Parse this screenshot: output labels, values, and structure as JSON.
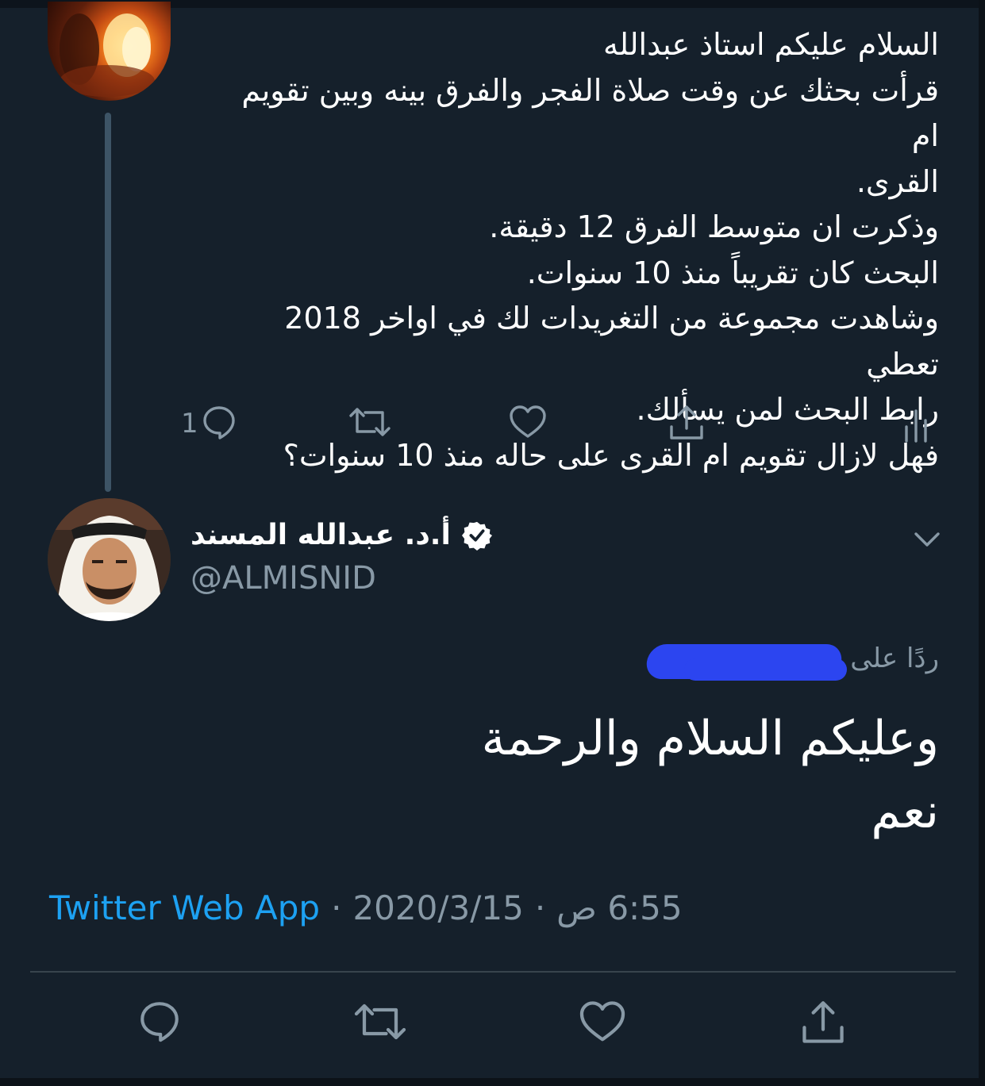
{
  "parent_tweet": {
    "lines": [
      "السلام عليكم استاذ عبدالله",
      "قرأت بحثك عن وقت صلاة الفجر والفرق بينه وبين تقويم ام",
      "القرى.",
      "وذكرت ان متوسط الفرق 12 دقيقة.",
      "البحث كان تقريباً منذ 10 سنوات.",
      "وشاهدت مجموعة من التغريدات لك في اواخر 2018 تعطي",
      "رابط البحث لمن يسألك.",
      "فهل لازال تقويم ام القرى على حاله منذ 10 سنوات؟"
    ],
    "reply_count": "1",
    "icons": [
      "reply-icon",
      "retweet-icon",
      "like-icon",
      "share-icon",
      "analytics-icon"
    ]
  },
  "main_tweet": {
    "display_name": "أ.د. عبدالله المسند",
    "handle": "@ALMISNID",
    "replying_to_prefix": "ردًا على",
    "text_lines": [
      "وعليكم السلام والرحمة",
      "نعم"
    ],
    "time": "6:55 ص",
    "date": "2020/3/15",
    "source": "Twitter Web App",
    "separator": "·"
  },
  "colors": {
    "background": "#15202b",
    "text": "#ffffff",
    "muted": "#8899a6",
    "link": "#1da1f2",
    "redaction": "#2c45f0"
  }
}
